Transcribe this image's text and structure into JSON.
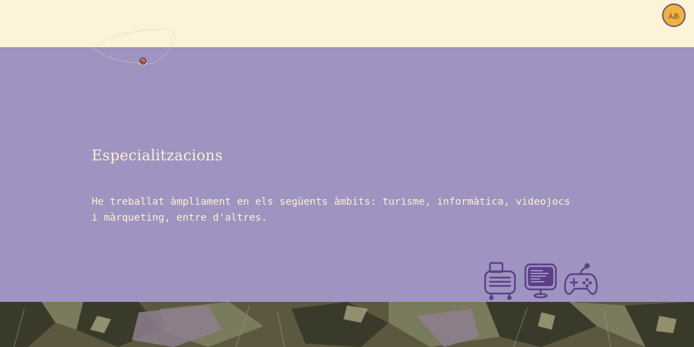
{
  "header": {
    "language_button_label": "Àあ"
  },
  "specializations": {
    "title": "Especialitzacions",
    "text": "He treballat àmpliament en els següents àmbits: turisme, informàtica, videojocs i màrqueting, entre d'altres."
  },
  "icons": [
    "radio-icon",
    "computer-monitor-icon",
    "gamepad-icon"
  ],
  "colors": {
    "cream": "#fdf3d9",
    "lavender": "#9f93c1",
    "text_cream": "#fdf1cf",
    "icon_purple": "#5a3f86",
    "language_button": "#f3b13f"
  }
}
